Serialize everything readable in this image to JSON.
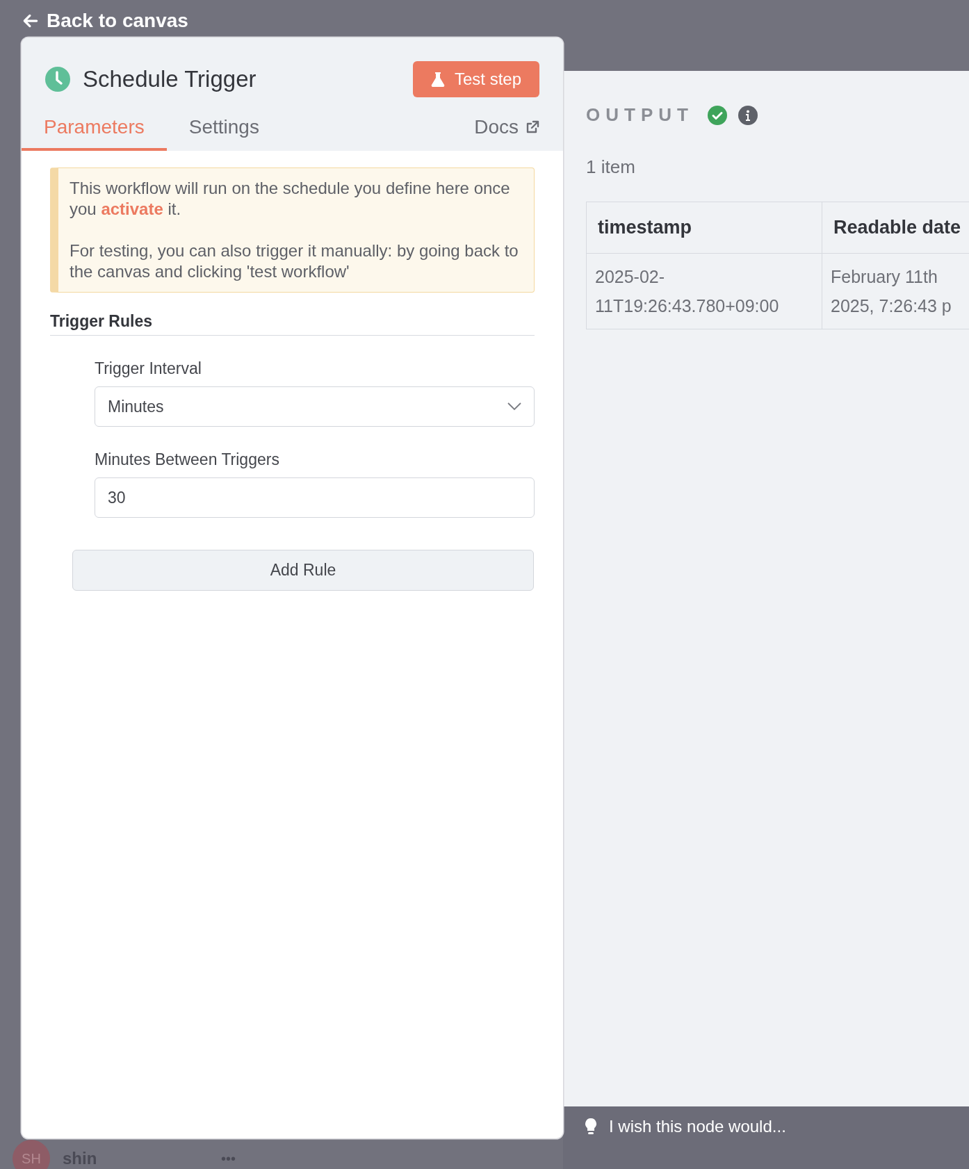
{
  "back_link": {
    "label": "Back to canvas"
  },
  "node_panel": {
    "title": "Schedule Trigger",
    "test_button": "Test step",
    "tabs": [
      {
        "label": "Parameters",
        "selected": true
      },
      {
        "label": "Settings",
        "selected": false
      }
    ],
    "docs_link": "Docs",
    "notice": [
      "This workflow will run on the schedule you define here once you **activate** it.",
      "For testing, you can also trigger it manually: by going back to the canvas and clicking 'test workflow'"
    ],
    "section_title": "Trigger Rules",
    "fields": [
      {
        "kind": "select",
        "label": "Trigger Interval",
        "value": "Minutes"
      },
      {
        "kind": "input",
        "label": "Minutes Between Triggers",
        "value": "30"
      }
    ],
    "add_button": "Add Rule"
  },
  "output": {
    "title": "OUTPUT",
    "count": "1 item",
    "table": {
      "columns": [
        "timestamp",
        "Readable date"
      ],
      "rows": [
        [
          "2025-02-11T19:26:43.780+09:00",
          "February 11th 2025, 7:26:43 p"
        ]
      ]
    }
  },
  "feedback": {
    "placeholder": "I wish this node would..."
  },
  "user": {
    "initials": "SH",
    "name": "shin",
    "menu": "•••"
  }
}
